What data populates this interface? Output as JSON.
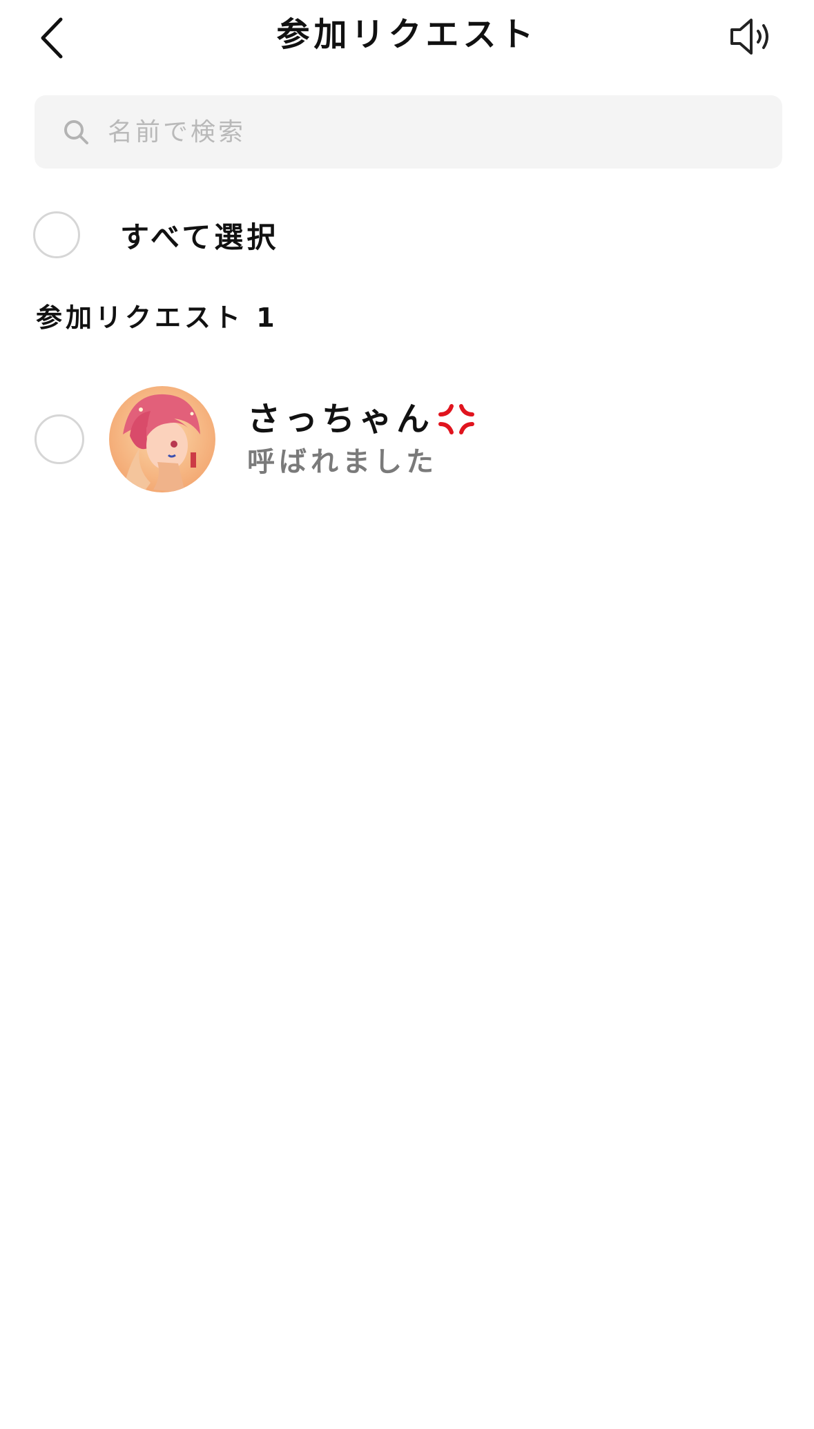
{
  "header": {
    "title": "参加リクエスト",
    "back_icon": "chevron-left-icon",
    "speaker_icon": "speaker-icon"
  },
  "search": {
    "placeholder": "名前で検索",
    "value": "",
    "icon": "search-icon"
  },
  "select_all": {
    "label": "すべて選択",
    "checked": false
  },
  "section": {
    "heading": "参加リクエスト 1"
  },
  "requests": [
    {
      "name": "さっちゃん",
      "name_emoji": "anger-symbol-icon",
      "message": "呼ばれました",
      "checked": false,
      "avatar": "user-avatar"
    }
  ],
  "colors": {
    "background": "#ffffff",
    "search_background": "#f4f4f4",
    "placeholder": "#b9b9b9",
    "checkbox_border": "#d6d6d6",
    "secondary_text": "#7a7a7a",
    "anger_red": "#e0141e"
  }
}
